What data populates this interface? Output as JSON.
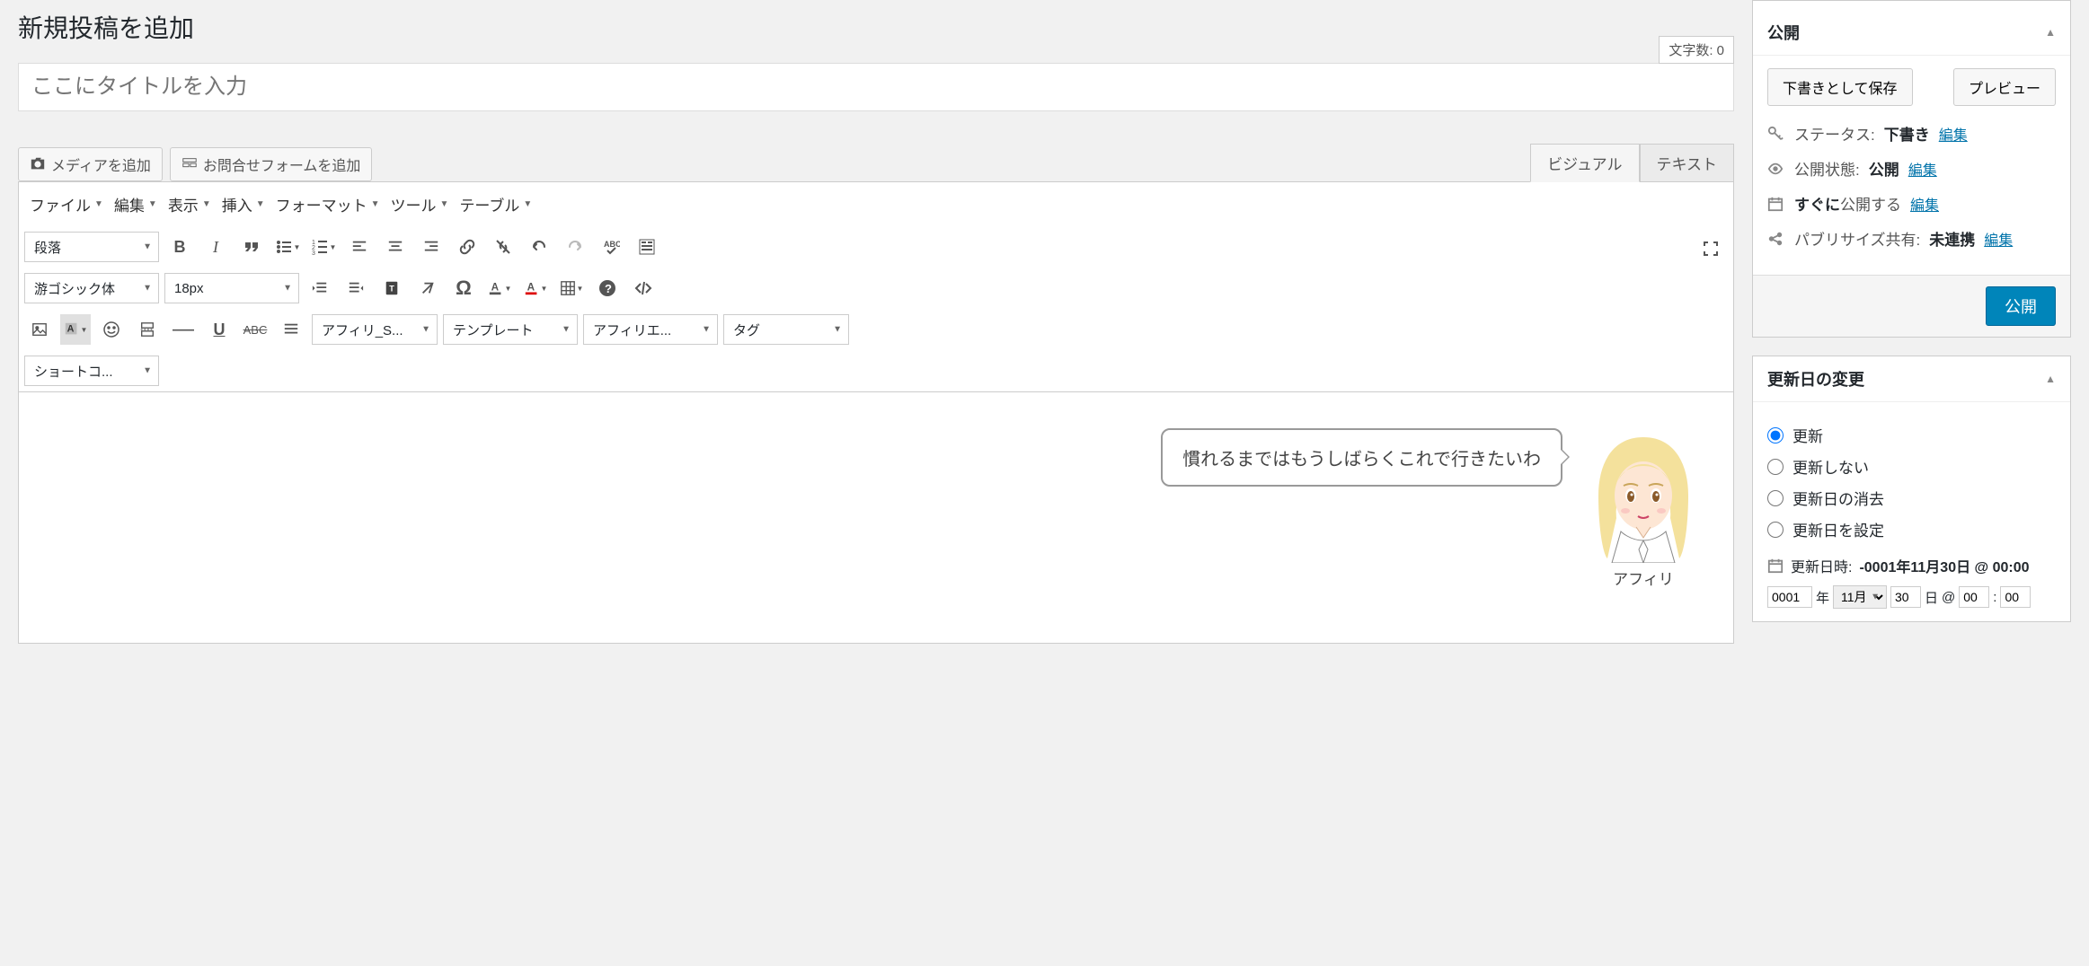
{
  "page_title": "新規投稿を追加",
  "word_count_label": "文字数:",
  "word_count_value": "0",
  "title_placeholder": "ここにタイトルを入力",
  "media_button": "メディアを追加",
  "contact_form_button": "お問合せフォームを追加",
  "tabs": {
    "visual": "ビジュアル",
    "text": "テキスト"
  },
  "menus": {
    "file": "ファイル",
    "edit": "編集",
    "view": "表示",
    "insert": "挿入",
    "format": "フォーマット",
    "tools": "ツール",
    "table": "テーブル"
  },
  "selects": {
    "paragraph": "段落",
    "font_family": "游ゴシック体",
    "font_size": "18px",
    "affili_s": "アフィリ_S...",
    "template": "テンプレート",
    "affiliate": "アフィリエ...",
    "tag": "タグ",
    "shortcode": "ショートコ..."
  },
  "speech_text": "慣れるまではもうしばらくこれで行きたいわ",
  "avatar_name": "アフィリ",
  "publish_box": {
    "title": "公開",
    "save_draft": "下書きとして保存",
    "preview": "プレビュー",
    "status_label": "ステータス:",
    "status_value": "下書き",
    "visibility_label": "公開状態:",
    "visibility_value": "公開",
    "schedule_prefix": "すぐに",
    "schedule_suffix": "公開する",
    "publicize_label": "パブリサイズ共有:",
    "publicize_value": "未連携",
    "edit": "編集",
    "publish_button": "公開"
  },
  "update_box": {
    "title": "更新日の変更",
    "opt_update": "更新",
    "opt_no_update": "更新しない",
    "opt_clear": "更新日の消去",
    "opt_set": "更新日を設定",
    "datetime_label": "更新日時:",
    "datetime_value": "-0001年11月30日 @ 00:00",
    "year_input": "0001",
    "year_suffix": "年",
    "month_select": "11月",
    "day_input": "30",
    "day_suffix": "日",
    "at": "@",
    "hour_input": "00",
    "min_input": "00"
  }
}
